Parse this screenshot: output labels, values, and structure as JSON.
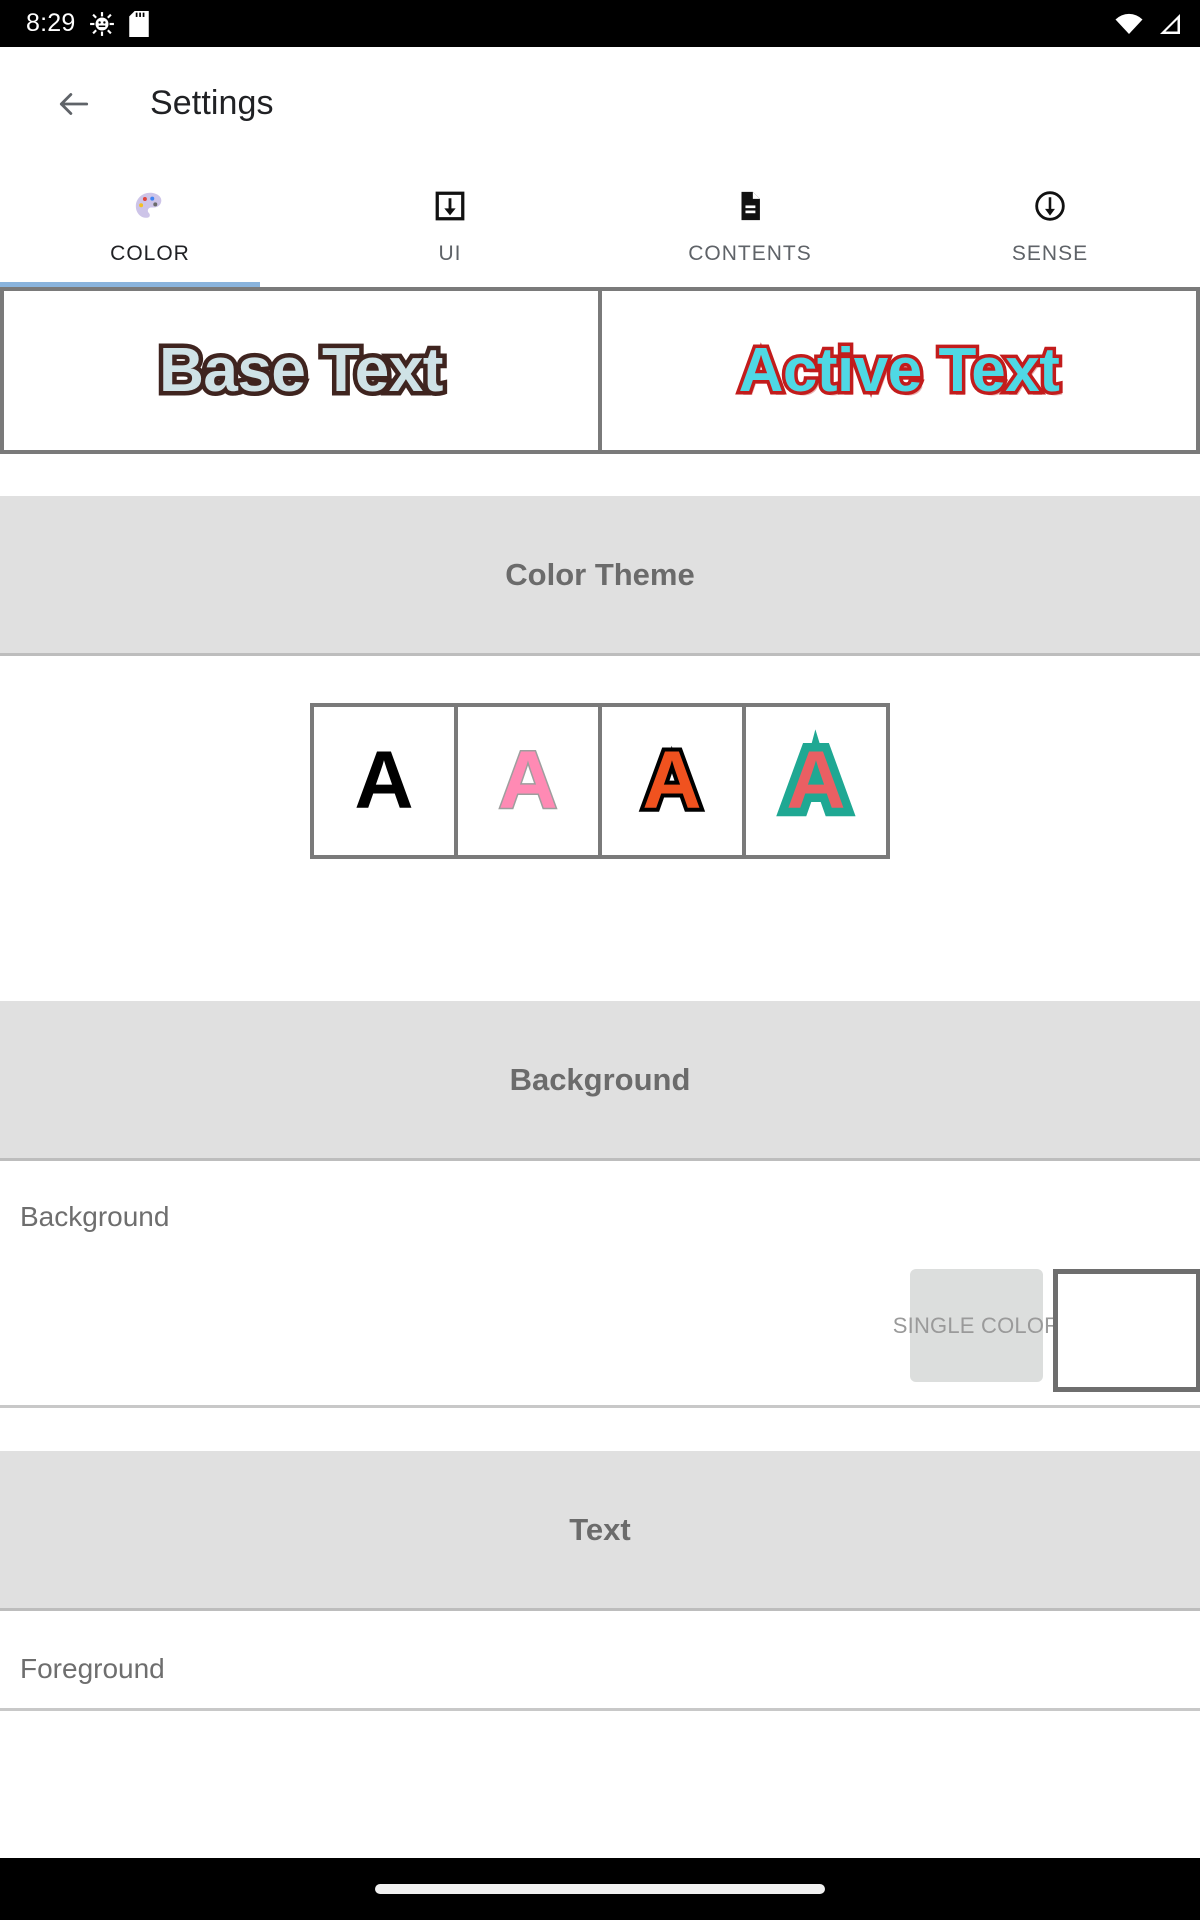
{
  "status_bar": {
    "time": "8:29",
    "icons": [
      "android-debug-icon",
      "sd-card-icon",
      "wifi-icon",
      "cellular-signal-icon"
    ]
  },
  "appbar": {
    "back_label": "back-arrow",
    "title": "Settings"
  },
  "tabs": {
    "active_index": 0,
    "items": [
      {
        "label": "COLOR",
        "icon": "palette-icon",
        "glyph": "🎨"
      },
      {
        "label": "UI",
        "icon": "download-box-icon",
        "glyph": ""
      },
      {
        "label": "CONTENTS",
        "icon": "document-icon",
        "glyph": ""
      },
      {
        "label": "SENSE",
        "icon": "circle-down-arrow-icon",
        "glyph": ""
      }
    ]
  },
  "preview": {
    "base": {
      "text": "Base Text",
      "fill": "#cfe2e6",
      "outline": "#3f241f"
    },
    "active": {
      "text": "Active Text",
      "fill": "#4fd8e4",
      "outline": "#c21c1c"
    }
  },
  "sections": {
    "color_theme": {
      "title": "Color Theme",
      "swatches": [
        {
          "letter": "A",
          "name": "theme-plain-black",
          "fill": "#000000",
          "outline": "#000000"
        },
        {
          "letter": "A",
          "name": "theme-pink",
          "fill": "#ff8ab4",
          "outline": "#9e9e9e"
        },
        {
          "letter": "A",
          "name": "theme-orange",
          "fill": "#f0521f",
          "outline": "#000000"
        },
        {
          "letter": "A",
          "name": "theme-teal",
          "fill": "#ea5f63",
          "outline": "#1fa893"
        }
      ]
    },
    "background": {
      "title": "Background",
      "row_label": "Background",
      "single_color_label": "SINGLE COLOR",
      "color_chip_value": "#ffffff"
    },
    "text": {
      "title": "Text",
      "row_label": "Foreground"
    }
  },
  "navbar": {
    "home_indicator": "home-pill"
  },
  "colors": {
    "accent": "#8ab4dd",
    "section_bg": "#e0e0e0",
    "border_gray": "#7a7a7a",
    "label_gray": "#6e6e6e"
  }
}
